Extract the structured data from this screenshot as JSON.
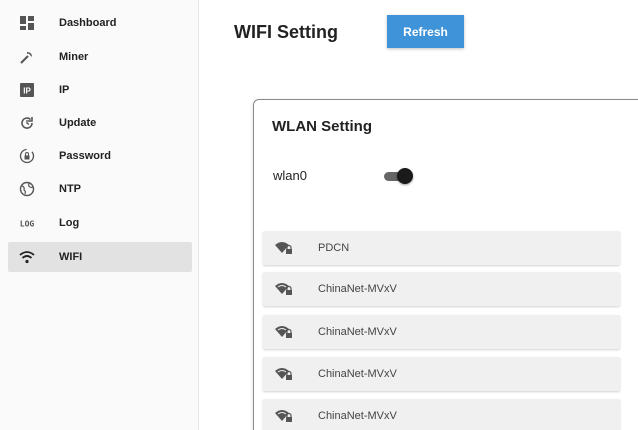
{
  "sidebar": {
    "items": [
      {
        "label": "Dashboard",
        "icon": "dashboard-icon"
      },
      {
        "label": "Miner",
        "icon": "pickaxe-icon"
      },
      {
        "label": "IP",
        "icon": "ip-icon",
        "icon_text": "IP"
      },
      {
        "label": "Update",
        "icon": "update-icon"
      },
      {
        "label": "Password",
        "icon": "lock-icon"
      },
      {
        "label": "NTP",
        "icon": "globe-icon"
      },
      {
        "label": "Log",
        "icon": "log-icon",
        "icon_text": "LOG"
      },
      {
        "label": "WIFI",
        "icon": "wifi-icon"
      }
    ],
    "active_index": 7
  },
  "header": {
    "title": "WIFI Setting",
    "refresh_label": "Refresh",
    "refresh_color": "#3f93d8"
  },
  "wlan": {
    "title": "WLAN Setting",
    "interface_label": "wlan0",
    "enabled": true
  },
  "networks": [
    {
      "ssid": "PDCN",
      "icon": "wifi-lock-icon"
    },
    {
      "ssid": "ChinaNet-MVxV",
      "icon": "wifi-lock-icon"
    },
    {
      "ssid": "ChinaNet-MVxV",
      "icon": "wifi-lock-icon"
    },
    {
      "ssid": "ChinaNet-MVxV",
      "icon": "wifi-lock-icon"
    },
    {
      "ssid": "ChinaNet-MVxV",
      "icon": "wifi-lock-icon"
    }
  ]
}
